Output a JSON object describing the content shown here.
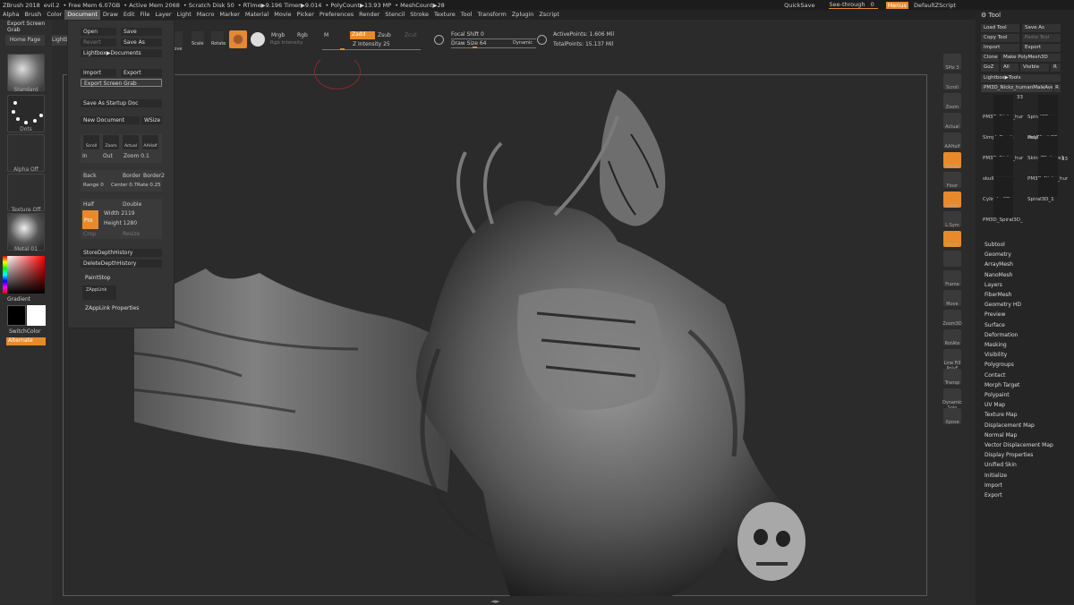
{
  "titlebar": {
    "app": "ZBrush 2018",
    "file": "evil.2",
    "free_mem": "• Free Mem 6.07GB",
    "active_mem": "• Active Mem 2068",
    "scratch": "• Scratch Disk 50",
    "rtime": "• RTime▶9.196 Timer▶9.014",
    "polycount": "• PolyCount▶13.93 MP",
    "meshcount": "• MeshCount▶28",
    "quicksave": "QuickSave",
    "see_through": "See-through",
    "see_through_val": "0",
    "menus": "Menus",
    "script": "DefaultZScript"
  },
  "menubar": [
    "Alpha",
    "Brush",
    "Color",
    "Document",
    "Draw",
    "Edit",
    "File",
    "Layer",
    "Light",
    "Macro",
    "Marker",
    "Material",
    "Movie",
    "Picker",
    "Preferences",
    "Render",
    "Stencil",
    "Stroke",
    "Texture",
    "Tool",
    "Transform",
    "Zplugin",
    "Zscript"
  ],
  "menubar_active": "Document",
  "left_shelf": {
    "export_grab": "Export Screen Grab",
    "home_page": "Home Page",
    "lightbox": "LightBox",
    "standard": "Standard",
    "dots": "Dots",
    "alpha_off": "Alpha Off",
    "texture_off": "Texture Off",
    "metal": "Metal 01",
    "gradient": "Gradient",
    "switch_color": "SwitchColor",
    "alternate": "Alternate"
  },
  "doc_menu": {
    "open": "Open",
    "save": "Save",
    "revert": "Revert",
    "save_as": "Save As",
    "lightbox_docs": "Lightbox▶Documents",
    "import": "Import",
    "export": "Export",
    "export_grab": "Export Screen Grab",
    "save_startup": "Save As Startup Doc",
    "new_doc": "New Document",
    "wsize": "WSize",
    "scroll": "Scroll",
    "zoom": "Zoom",
    "actual": "Actual",
    "aahalf": "AAHalf",
    "in": "In",
    "out": "Out",
    "zoom_label": "Zoom",
    "zoom_val": "0.1",
    "back": "Back",
    "border": "Border",
    "border2": "Border2",
    "range": "Range",
    "range_val": "0",
    "center": "Center",
    "center_val": "0.7",
    "rate": "Rate",
    "rate_val": "0.25",
    "half": "Half",
    "double": "Double",
    "pro": "Pro",
    "width_label": "Width",
    "width_val": "2119",
    "height_label": "Height",
    "height_val": "1280",
    "crop": "Crop",
    "resize": "Resize",
    "store_depth": "StoreDepthHistory",
    "delete_depth": "DeleteDepthHistory",
    "paintstop": "PaintStop",
    "zapplink": "ZAppLink",
    "zapplink_props": "ZAppLink Properties"
  },
  "topbar": {
    "move": "Move",
    "scale": "Scale",
    "rotate": "Rotate",
    "mrgb": "Mrgb",
    "rgb": "Rgb",
    "m": "M",
    "rgb_intensity": "Rgb Intensity",
    "zadd": "Zadd",
    "zsub": "Zsub",
    "zcut": "Zcut",
    "z_intensity": "Z Intensity",
    "z_intensity_val": "25",
    "focal_shift": "Focal Shift",
    "focal_val": "0",
    "draw_size": "Draw Size",
    "draw_val": "64",
    "dynamic": "Dynamic",
    "active_points": "ActivePoints: 1.606 Mil",
    "total_points": "TotalPoints: 15.137 Mil"
  },
  "right_shelf": [
    "SPix 3",
    "Scroll",
    "Zoom",
    "Actual",
    "AAHalf",
    "Persp",
    "Floor",
    "Local",
    "L.Sym",
    "Qxyz",
    "",
    "Frame",
    "Move",
    "Zoom3D",
    "RotAte",
    "Line Fill PolyF",
    "Transp",
    "Dynamic Solo",
    "Xpose"
  ],
  "tool_panel": {
    "title": "Tool",
    "load_tool": "Load Tool",
    "save_as": "Save As",
    "copy_tool": "Copy Tool",
    "paste_tool": "Paste Tool",
    "import": "Import",
    "export": "Export",
    "clone": "Clone",
    "make_polymesh": "Make PolyMesh3D",
    "goz": "GoZ",
    "all": "All",
    "visible": "Visible",
    "r": "R",
    "lightbox_tools": "Lightbox▶Tools",
    "current_tool": "PM3D_Nickz_humanMaleAve",
    "thumbs": [
      {
        "label": "PM3D_Nickz_hur",
        "badge": "33"
      },
      {
        "label": "Spiral3D",
        "badge": ""
      },
      {
        "label": "PolyMesh3D",
        "badge": ""
      },
      {
        "label": "SimpleBrush",
        "badge": ""
      },
      {
        "label": "skull",
        "badge": ""
      },
      {
        "label": "PM3D_Nickz_hur",
        "badge": ""
      },
      {
        "label": "Skin_ZSphere1",
        "badge": ""
      },
      {
        "label": "skull",
        "badge": ""
      },
      {
        "label": "PM3D_Nickz_hur",
        "badge": "33"
      },
      {
        "label": "Cylinder3D",
        "badge": ""
      },
      {
        "label": "Spiral3D_1",
        "badge": ""
      },
      {
        "label": "PM3D_Spiral3D_",
        "badge": ""
      }
    ],
    "list": [
      "Subtool",
      "Geometry",
      "ArrayMesh",
      "NanoMesh",
      "Layers",
      "FiberMesh",
      "Geometry HD",
      "Preview",
      "Surface",
      "Deformation",
      "Masking",
      "Visibility",
      "Polygroups",
      "Contact",
      "Morph Target",
      "Polypaint",
      "UV Map",
      "Texture Map",
      "Displacement Map",
      "Normal Map",
      "Vector Displacement Map",
      "Display Properties",
      "Unified Skin",
      "Initialize",
      "Import",
      "Export"
    ]
  },
  "colors": {
    "accent": "#e88a2a",
    "bg": "#2b2b2b",
    "panel": "#343434"
  }
}
